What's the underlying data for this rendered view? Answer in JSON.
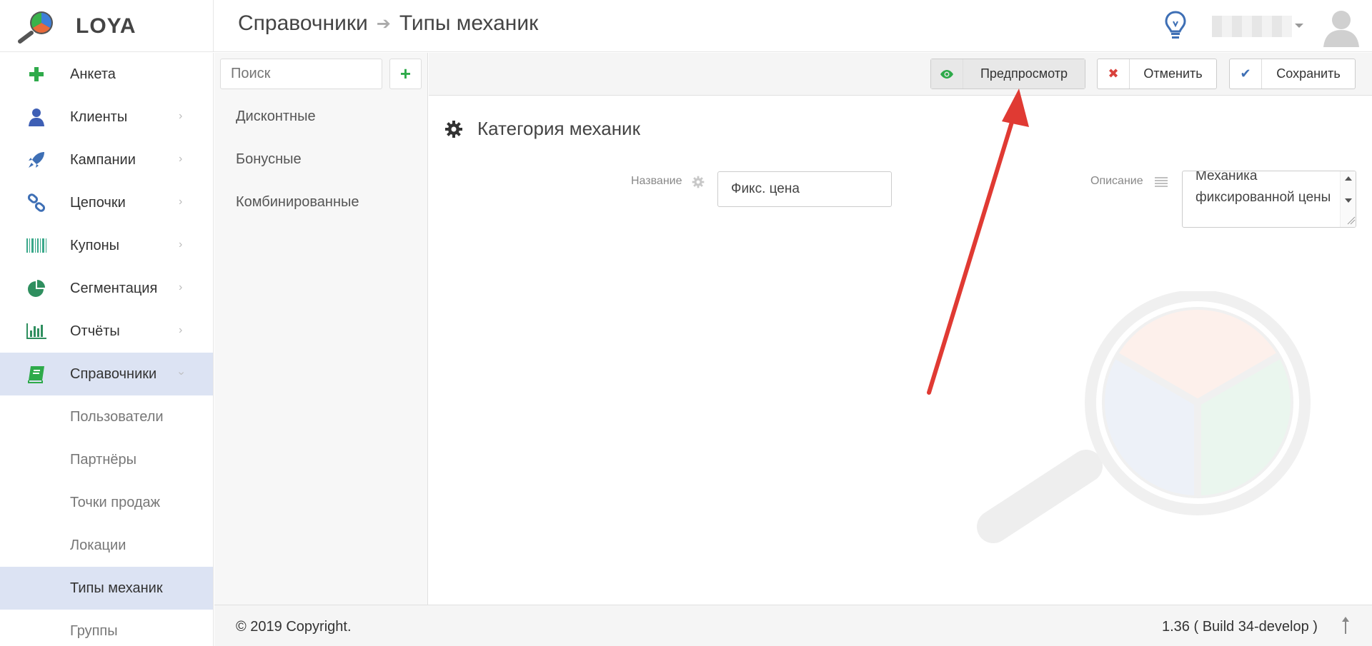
{
  "app": {
    "name": "LOYA"
  },
  "breadcrumb": {
    "parent": "Справочники",
    "current": "Типы механик"
  },
  "sidebar": {
    "items": [
      {
        "label": "Анкета",
        "icon": "plus-icon",
        "has_children": false
      },
      {
        "label": "Клиенты",
        "icon": "user-icon",
        "has_children": true
      },
      {
        "label": "Кампании",
        "icon": "rocket-icon",
        "has_children": true
      },
      {
        "label": "Цепочки",
        "icon": "chain-icon",
        "has_children": true
      },
      {
        "label": "Купоны",
        "icon": "barcode-icon",
        "has_children": true
      },
      {
        "label": "Сегментация",
        "icon": "pie-icon",
        "has_children": true
      },
      {
        "label": "Отчёты",
        "icon": "bar-chart-icon",
        "has_children": true
      },
      {
        "label": "Справочники",
        "icon": "book-icon",
        "has_children": true,
        "expanded": true
      }
    ],
    "sub_items": [
      {
        "label": "Пользователи"
      },
      {
        "label": "Партнёры"
      },
      {
        "label": "Точки продаж"
      },
      {
        "label": "Локации"
      },
      {
        "label": "Типы механик",
        "active": true
      },
      {
        "label": "Группы"
      }
    ]
  },
  "list": {
    "search_placeholder": "Поиск",
    "add_label": "+",
    "categories": [
      "Дисконтные",
      "Бонусные",
      "Комбинированные"
    ]
  },
  "toolbar": {
    "preview_label": "Предпросмотр",
    "cancel_label": "Отменить",
    "save_label": "Сохранить"
  },
  "form": {
    "section_title": "Категория механик",
    "name_label": "Название",
    "name_value": "Фикс. цена",
    "description_label": "Описание",
    "description_value": "Механика фиксированной цены"
  },
  "footer": {
    "copyright": "© 2019 Copyright.",
    "version": "1.36 ( Build 34-develop )"
  },
  "colors": {
    "active_bg": "#dce3f3",
    "green": "#2eaa4a",
    "red": "#d9413b",
    "blue": "#3e6fb5"
  }
}
